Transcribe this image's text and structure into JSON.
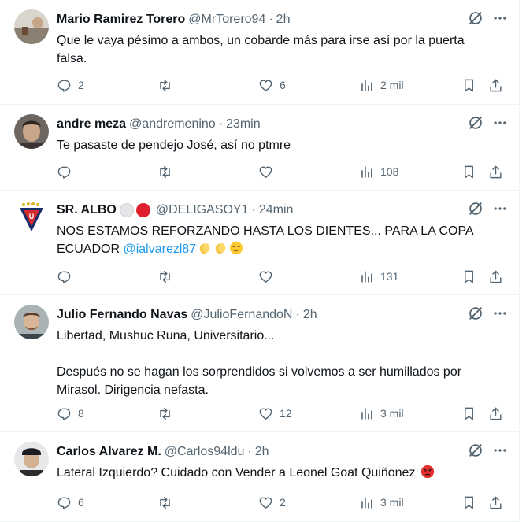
{
  "tweets": [
    {
      "name": "Mario Ramirez Torero",
      "handle": "@MrTorero94",
      "time": "2h",
      "lines": [
        "Que le vaya pésimo a ambos, un cobarde más para irse así por la puerta",
        "falsa."
      ],
      "replies": "2",
      "retweets": "",
      "likes": "6",
      "views": "2 mil"
    },
    {
      "name": "andre meza",
      "handle": "@andremenino",
      "time": "23min",
      "lines": [
        "Te pasaste de pendejo José, así no ptmre"
      ],
      "replies": "",
      "retweets": "",
      "likes": "",
      "views": "108"
    },
    {
      "name": "SR. ALBO",
      "handle": "@DELIGASOY1",
      "time": "24min",
      "lines": [
        "NOS ESTAMOS REFORZANDO HASTA LOS DIENTES... PARA LA COPA",
        "ECUADOR"
      ],
      "mention": "@ialvarezl87",
      "emojis": [
        "clapping-hands-emoji",
        "clapping-hands-emoji",
        "unamused-face-emoji"
      ],
      "replies": "",
      "retweets": "",
      "likes": "",
      "views": "131"
    },
    {
      "name": "Julio Fernando Navas",
      "handle": "@JulioFernandoN",
      "time": "2h",
      "lines": [
        "Libertad, Mushuc Runa, Universitario...",
        "",
        "Después no se hagan los sorprendidos si volvemos a ser humillados por",
        "Mirasol. Dirigencia nefasta."
      ],
      "replies": "8",
      "retweets": "",
      "likes": "12",
      "views": "3 mil"
    },
    {
      "name": "Carlos Alvarez M.",
      "handle": "@Carlos94ldu",
      "time": "2h",
      "lines": [
        "Lateral Izquierdo? Cuidado con Vender a Leonel Goat Quiñonez"
      ],
      "emojis": [
        "angry-face-emoji"
      ],
      "replies": "6",
      "retweets": "",
      "likes": "2",
      "views": "3 mil"
    }
  ],
  "separator": "·",
  "colors": {
    "text": "#0f1419",
    "secondary": "#536471",
    "link": "#1d9bf0",
    "border": "#eff3f4"
  }
}
